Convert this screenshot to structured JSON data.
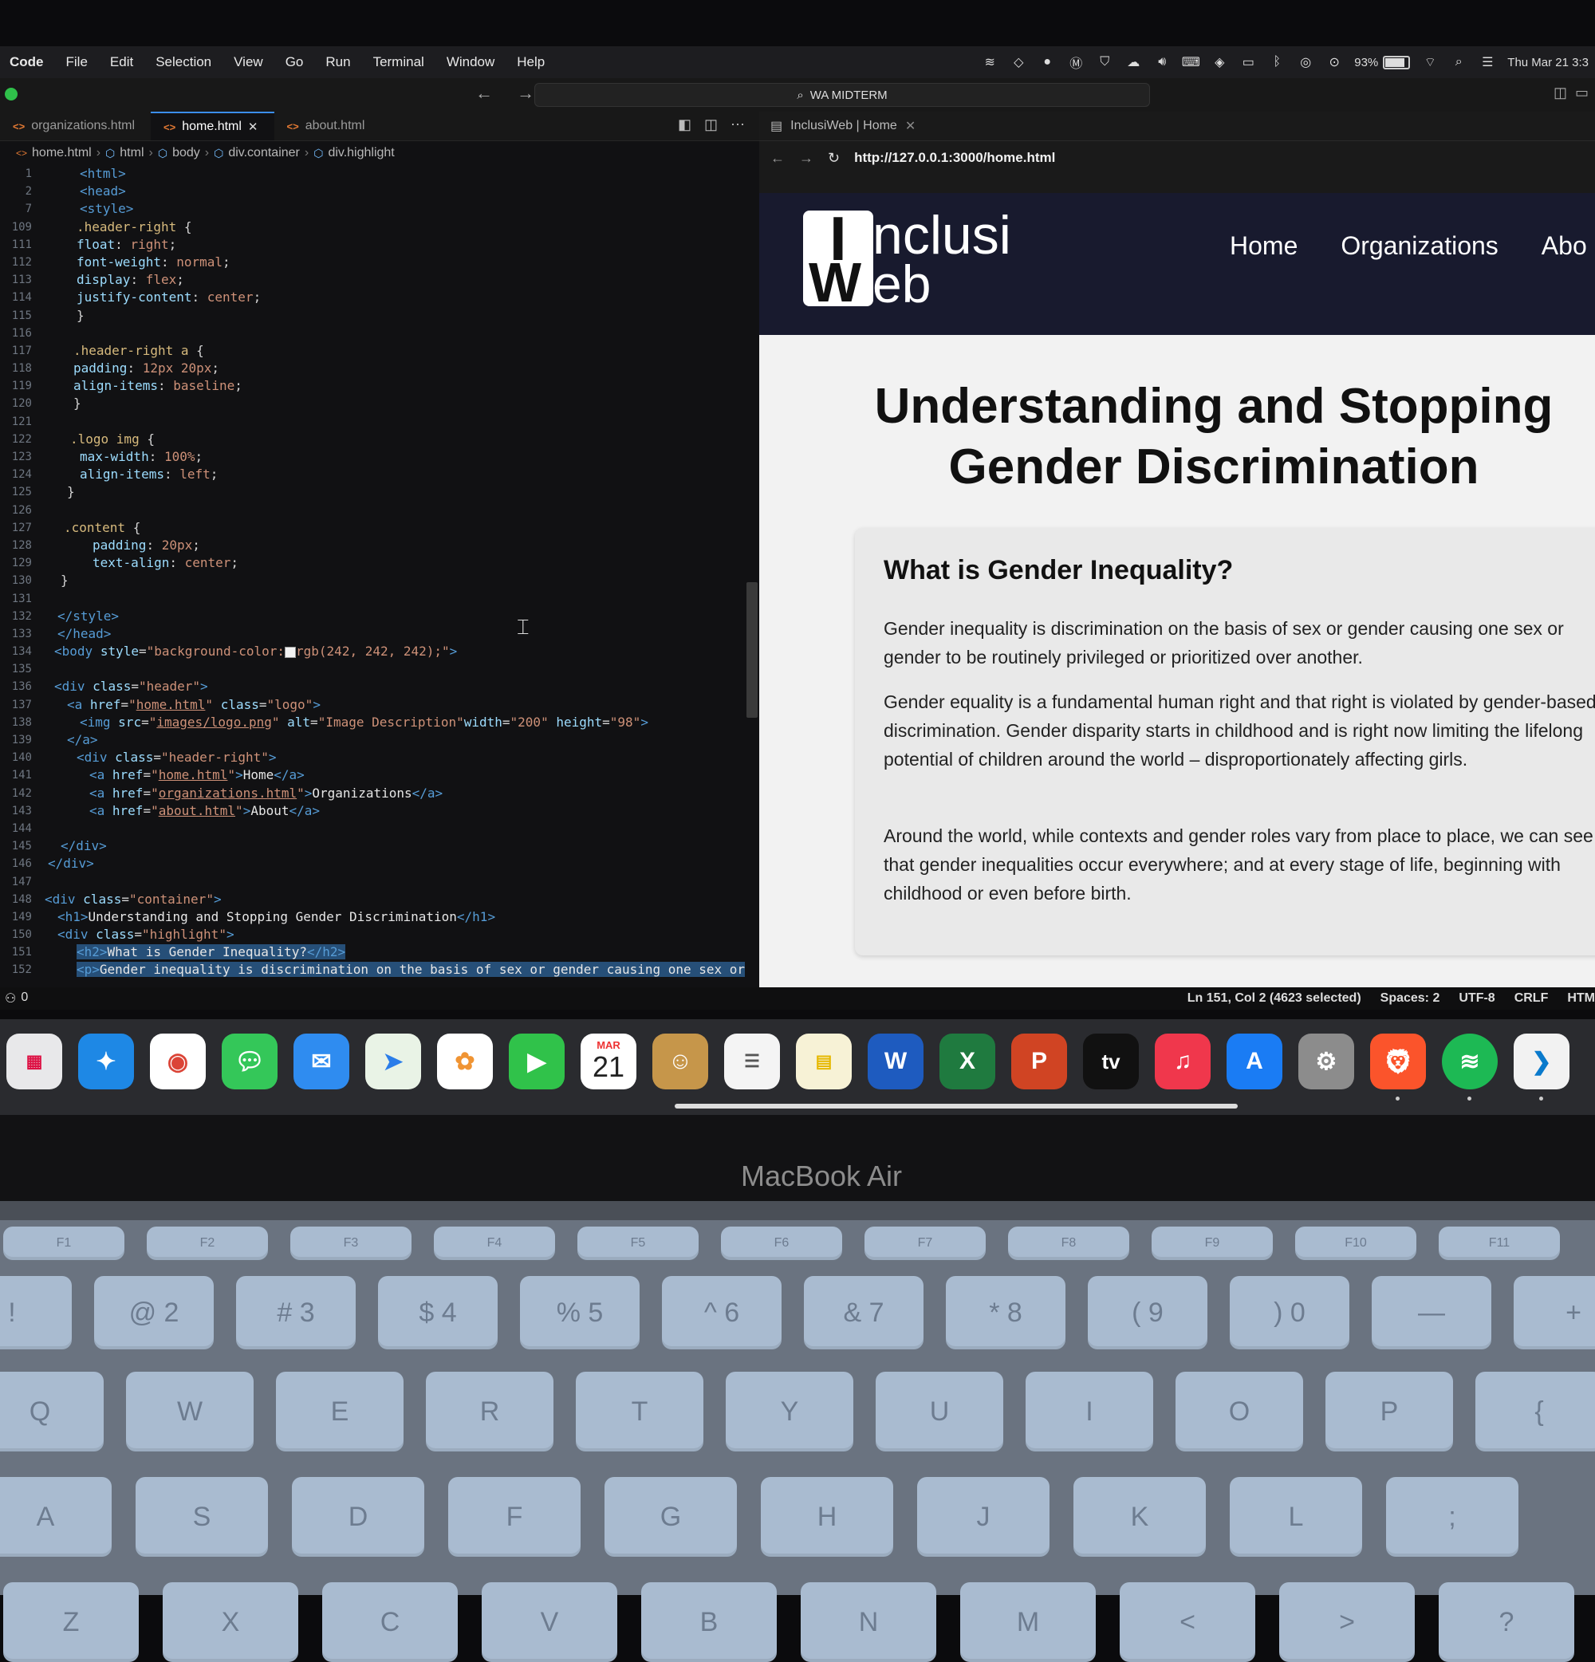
{
  "menubar": {
    "items": [
      "Code",
      "File",
      "Edit",
      "Selection",
      "View",
      "Go",
      "Run",
      "Terminal",
      "Window",
      "Help"
    ],
    "battery_percent": "93%",
    "battery_level": 0.93,
    "datetime": "Thu Mar 21 3:3"
  },
  "window": {
    "command_center": "WA MIDTERM",
    "nav_arrows": "← →"
  },
  "editor": {
    "tabs": [
      {
        "label": "organizations.html",
        "active": false
      },
      {
        "label": "home.html",
        "active": true
      },
      {
        "label": "about.html",
        "active": false
      }
    ],
    "tab_close": "✕",
    "breadcrumbs": [
      "home.html",
      "html",
      "body",
      "div.container",
      "div.highlight"
    ],
    "line_numbers": [
      "1",
      "2",
      "7",
      "109",
      "111",
      "112",
      "113",
      "114",
      "115",
      "116",
      "117",
      "118",
      "119",
      "120",
      "121",
      "122",
      "123",
      "124",
      "125",
      "126",
      "127",
      "128",
      "129",
      "130",
      "131",
      "132",
      "133",
      "134",
      "135",
      "136",
      "137",
      "138",
      "139",
      "140",
      "141",
      "142",
      "143",
      "144",
      "145",
      "146",
      "147",
      "148",
      "149",
      "150",
      "151",
      "152"
    ]
  },
  "browser": {
    "tab_title": "InclusiWeb | Home",
    "url": "http://127.0.0.1:3000/home.html",
    "site": {
      "logo_letters": [
        "I",
        "nclusi",
        "W",
        "eb"
      ],
      "nav": [
        "Home",
        "Organizations",
        "Abo"
      ],
      "h1_line1": "Understanding and Stopping",
      "h1_line2": "Gender Discrimination",
      "h2": "What is Gender Inequality?",
      "paragraphs": [
        "Gender inequality is discrimination on the basis of sex or gender causing one sex or gender to be routinely privileged or prioritized over another.",
        "Gender equality is a fundamental human right and that right is violated by gender-based discrimination. Gender disparity starts in childhood and is right now limiting the lifelong potential of children around the world – disproportionately affecting girls.",
        "Around the world, while contexts and gender roles vary from place to place, we can see that gender inequalities occur everywhere; and at every stage of life, beginning with childhood or even before birth."
      ]
    }
  },
  "statusbar": {
    "problems": "0",
    "position": "Ln 151, Col 2 (4623 selected)",
    "spaces": "Spaces: 2",
    "encoding": "UTF-8",
    "eol": "CRLF",
    "language": "HTM"
  },
  "dock": {
    "calendar_month": "MAR",
    "calendar_day": "21",
    "tv_label": "tv"
  },
  "laptop": {
    "brand": "MacBook Air"
  },
  "keyboard": {
    "fn_row": [
      "F1",
      "F2",
      "F3",
      "F4",
      "F5",
      "F6",
      "F7",
      "F8",
      "F9",
      "F10",
      "F11"
    ],
    "number_row": [
      "!",
      "@ 2",
      "# 3",
      "$ 4",
      "% 5",
      "^ 6",
      "& 7",
      "* 8",
      "( 9",
      ") 0",
      "—",
      "+"
    ],
    "row_q": [
      "Q",
      "W",
      "E",
      "R",
      "T",
      "Y",
      "U",
      "I",
      "O",
      "P",
      "{"
    ],
    "row_a": [
      "A",
      "S",
      "D",
      "F",
      "G",
      "H",
      "J",
      "K",
      "L",
      ";"
    ],
    "row_z": [
      "Z",
      "X",
      "C",
      "V",
      "B",
      "N",
      "M",
      "<",
      ">",
      "?"
    ]
  },
  "colors": {
    "site_header_bg": "#181a2e",
    "site_body_bg": "#f2f2f2",
    "editor_bg": "#111113",
    "accent_blue": "#3b8eea",
    "selection": "#264f78"
  }
}
